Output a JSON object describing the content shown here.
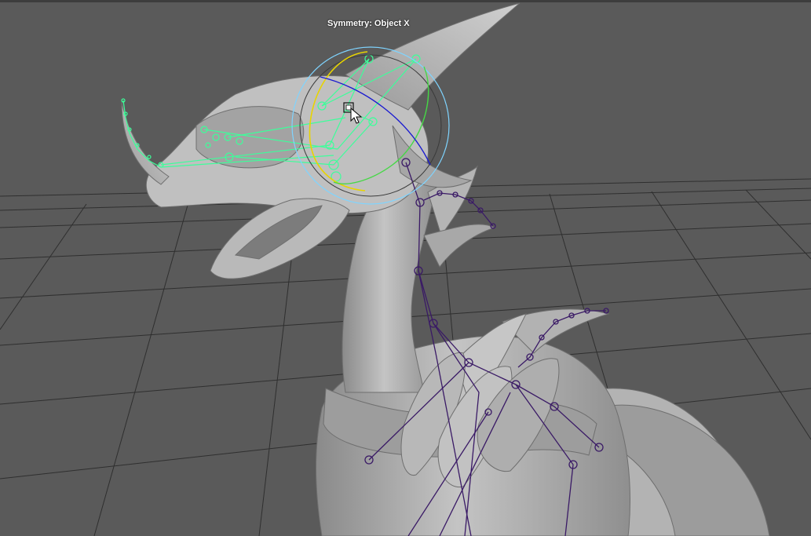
{
  "viewport": {
    "symmetry_label": "Symmetry: Object X",
    "background_color": "#5a5a5a",
    "grid_color": "#2f2f2f",
    "model_color": "#a7a7a7",
    "skeleton_color": "#3a1a66",
    "selected_control_color": "#3cff9a",
    "rotate_ring_x_color": "#e8d400",
    "rotate_ring_y_color": "#45d845",
    "rotate_ring_z_color": "#1a1ad0",
    "rotate_ring_view_color": "#7fd4ff"
  },
  "icons": {
    "cursor": "arrow-cursor-icon",
    "pivot": "pivot-square-icon"
  }
}
